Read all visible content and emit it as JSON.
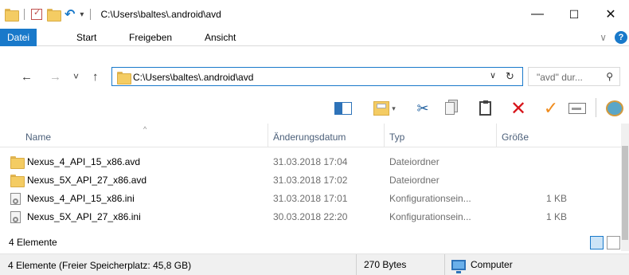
{
  "window": {
    "title": "C:\\Users\\baltes\\.android\\avd",
    "minimize": "—",
    "maximize": "☐",
    "close": "✕"
  },
  "ribbon": {
    "tabs": [
      "Datei",
      "Start",
      "Freigeben",
      "Ansicht"
    ],
    "collapse_icon": "chevron-down-icon",
    "help_icon": "help-icon"
  },
  "nav": {
    "back": "←",
    "forward": "→",
    "recent": "˅",
    "up": "↑",
    "address": "C:\\Users\\baltes\\.android\\avd",
    "address_dropdown": "∨",
    "refresh": "↻",
    "search_placeholder": "\"avd\" dur...",
    "search_icon": "⌕"
  },
  "toolbar": {
    "icons": [
      "preview-pane-icon",
      "properties-icon",
      "cut-icon",
      "copy-icon",
      "paste-icon",
      "delete-icon",
      "checkmark-icon",
      "rename-icon",
      "shell-icon"
    ],
    "accent_delete": "#d7141a",
    "accent_check": "#f08c1e"
  },
  "columns": {
    "name": "Name",
    "date": "Änderungsdatum",
    "type": "Typ",
    "size": "Größe"
  },
  "files": [
    {
      "name": "Nexus_4_API_15_x86.avd",
      "date": "31.03.2018 17:04",
      "type": "Dateiordner",
      "size": "",
      "kind": "folder"
    },
    {
      "name": "Nexus_5X_API_27_x86.avd",
      "date": "31.03.2018 17:02",
      "type": "Dateiordner",
      "size": "",
      "kind": "folder"
    },
    {
      "name": "Nexus_4_API_15_x86.ini",
      "date": "31.03.2018 17:01",
      "type": "Konfigurationsein...",
      "size": "1 KB",
      "kind": "ini"
    },
    {
      "name": "Nexus_5X_API_27_x86.ini",
      "date": "30.03.2018 22:20",
      "type": "Konfigurationsein...",
      "size": "1 KB",
      "kind": "ini"
    }
  ],
  "items_count": "4 Elemente",
  "status": {
    "left": "4 Elemente (Freier Speicherplatz: 45,8 GB)",
    "middle": "270 Bytes",
    "right": "Computer"
  },
  "colors": {
    "accent": "#1979ca",
    "folder": "#f4cc63"
  }
}
